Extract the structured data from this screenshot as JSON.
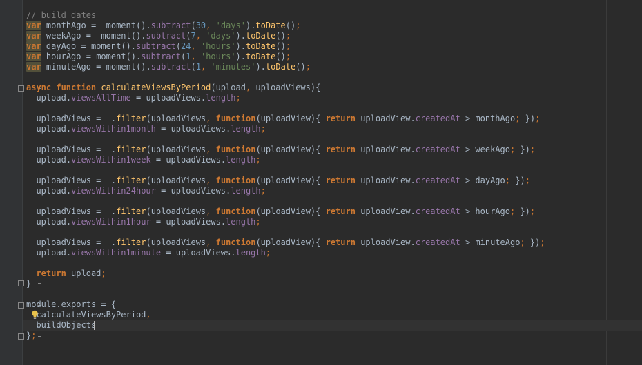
{
  "editor": {
    "theme": "darcula",
    "colors": {
      "background": "#2b2b2b",
      "gutter": "#313335",
      "keyword": "#cc7832",
      "comment": "#808080",
      "string": "#6a8759",
      "number": "#6897bb",
      "property": "#9876aa",
      "function": "#ffc66d",
      "default": "#a9b7c6"
    },
    "intention_icon": "lightbulb-icon"
  },
  "code": {
    "comment_build_dates": "// build dates",
    "kw_var": "var",
    "kw_async": "async",
    "kw_function": "function",
    "kw_return": "return",
    "id_monthAgo": "monthAgo",
    "id_weekAgo": "weekAgo",
    "id_dayAgo": "dayAgo",
    "id_hourAgo": "hourAgo",
    "id_minuteAgo": "minuteAgo",
    "id_moment": "moment",
    "m_subtract": "subtract",
    "m_toDate": "toDate",
    "m_filter": "filter",
    "n_30": "30",
    "n_7": "7",
    "n_24": "24",
    "n_1": "1",
    "s_days": "'days'",
    "s_hours": "'hours'",
    "s_minutes": "'minutes'",
    "fn_calculateViewsByPeriod": "calculateViewsByPeriod",
    "id_upload": "upload",
    "id_uploadViews": "uploadViews",
    "id_uploadView": "uploadView",
    "id_underscore": "_",
    "p_viewsAllTime": "viewsAllTime",
    "p_length": "length",
    "p_createdAt": "createdAt",
    "p_viewsWithin1month": "viewsWithin1month",
    "p_viewsWithin1week": "viewsWithin1week",
    "p_viewsWithin24hour": "viewsWithin24hour",
    "p_viewsWithin1hour": "viewsWithin1hour",
    "p_viewsWithin1minute": "viewsWithin1minute",
    "id_module": "module",
    "id_exports": "exports",
    "id_calculateViewsByPeriod": "calculateViewsByPeriod",
    "id_buildObjects": "buildObjects"
  }
}
